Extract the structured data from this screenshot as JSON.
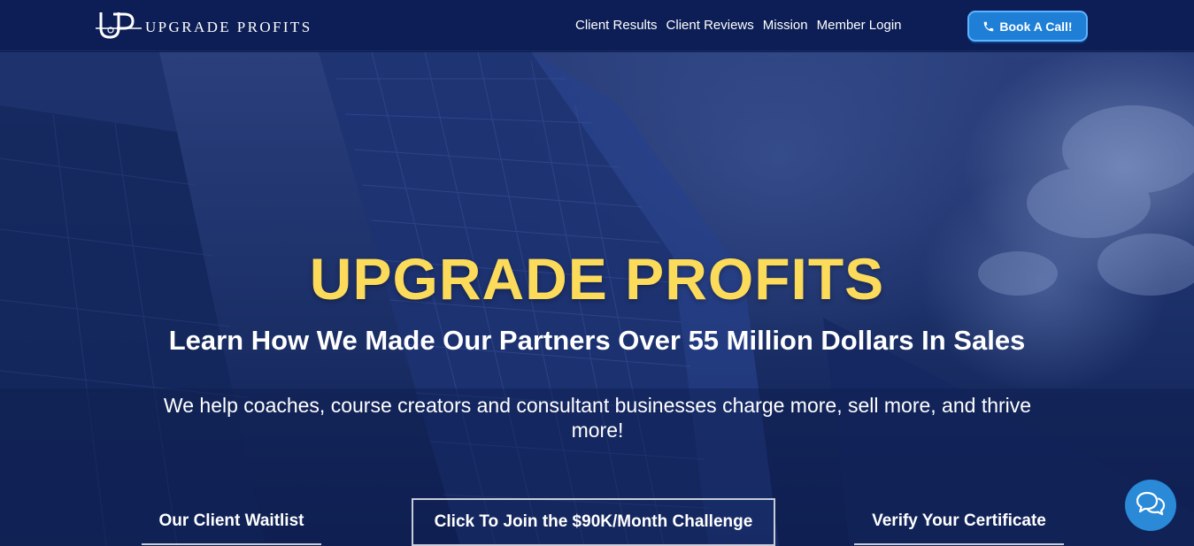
{
  "header": {
    "brand_name": "UPGRADE PROFITS",
    "nav_items": [
      {
        "label": "Client Results"
      },
      {
        "label": "Client Reviews"
      },
      {
        "label": "Mission"
      },
      {
        "label": "Member Login"
      }
    ],
    "book_button_label": "Book A Call!"
  },
  "hero": {
    "title": "UPGRADE PROFITS",
    "subtitle": "Learn How We Made Our Partners Over 55 Million Dollars In Sales",
    "description": "We help coaches, course creators and consultant businesses charge more, sell more, and thrive more!"
  },
  "ctas": {
    "waitlist": "Our Client Waitlist",
    "challenge": "Click To Join the $90K/Month Challenge",
    "verify": "Verify Your Certificate"
  },
  "icons": {
    "logo": "up-monogram-icon",
    "phone": "phone-icon",
    "chat": "chat-bubbles-icon"
  },
  "colors": {
    "header_bg": "#0c1e55",
    "hero_title": "#fddb5a",
    "book_button": "#1f7fd6",
    "chat_button": "#2a8ad8"
  }
}
